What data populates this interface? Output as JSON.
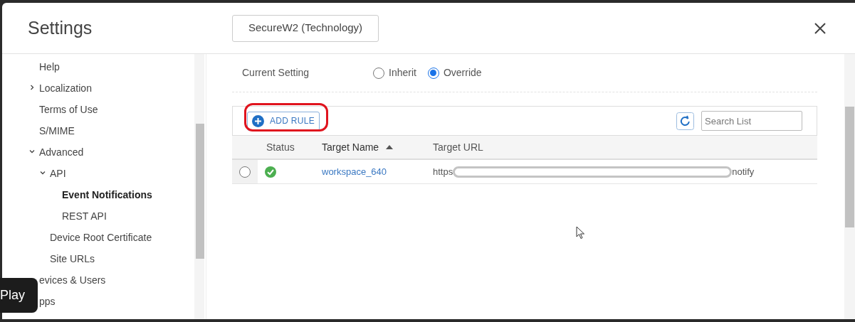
{
  "window": {
    "title": "Settings",
    "tenant": "SecureW2 (Technology)"
  },
  "sidebar": {
    "items": [
      {
        "label": "Help",
        "selected": false
      },
      {
        "label": "Localization",
        "selected": false,
        "expanded": false
      },
      {
        "label": "Terms of Use",
        "selected": false
      },
      {
        "label": "S/MIME",
        "selected": false
      },
      {
        "label": "Advanced",
        "selected": false,
        "expanded": true,
        "children": [
          {
            "label": "API",
            "selected": false,
            "expanded": true,
            "children": [
              {
                "label": "Event Notifications",
                "selected": true
              },
              {
                "label": "REST API",
                "selected": false
              }
            ]
          },
          {
            "label": "Device Root Certificate",
            "selected": false
          },
          {
            "label": "Site URLs",
            "selected": false
          }
        ]
      },
      {
        "label": "evices & Users",
        "selected": false
      },
      {
        "label": "pps",
        "selected": false
      }
    ]
  },
  "current_setting": {
    "label": "Current Setting",
    "options": [
      {
        "label": "Inherit",
        "selected": false
      },
      {
        "label": "Override",
        "selected": true
      }
    ]
  },
  "toolbar": {
    "add_button": "ADD RULE",
    "search": {
      "placeholder": "Search List"
    }
  },
  "table": {
    "columns": [
      {
        "label": "Status",
        "sorted": false
      },
      {
        "label": "Target Name",
        "sorted": true
      },
      {
        "label": "Target URL",
        "sorted": false
      }
    ],
    "rows": [
      {
        "selected": false,
        "kind": "ok",
        "name": "workspace_640",
        "url_prefix": "https",
        "url_suffix": "notify"
      }
    ]
  },
  "overlay": {
    "play": "Play"
  }
}
